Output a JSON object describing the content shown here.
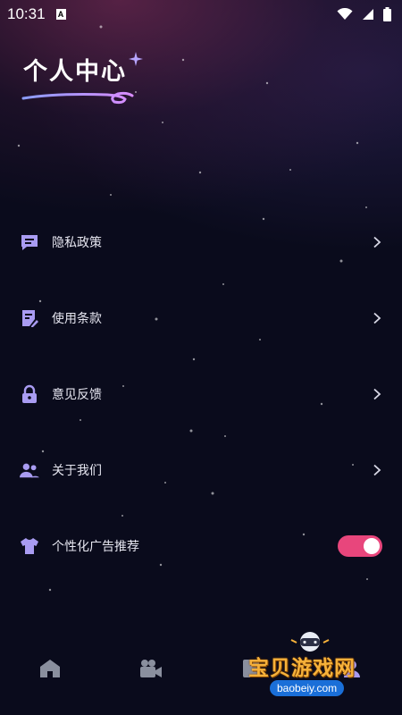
{
  "status_bar": {
    "time": "10:31",
    "notification_letter": "A",
    "icons": [
      "wifi-icon",
      "signal-icon",
      "battery-icon"
    ]
  },
  "header": {
    "title": "个人中心"
  },
  "menu": {
    "items": [
      {
        "label": "隐私政策",
        "icon": "message-square-icon",
        "action": "chevron-right"
      },
      {
        "label": "使用条款",
        "icon": "document-edit-icon",
        "action": "chevron-right"
      },
      {
        "label": "意见反馈",
        "icon": "lock-icon",
        "action": "chevron-right"
      },
      {
        "label": "关于我们",
        "icon": "users-icon",
        "action": "chevron-right"
      },
      {
        "label": "个性化广告推荐",
        "icon": "tshirt-icon",
        "action": "toggle",
        "toggle_on": true
      }
    ]
  },
  "bottom_nav": {
    "items": [
      {
        "icon": "home-icon"
      },
      {
        "icon": "video-camera-icon"
      },
      {
        "icon": "book-icon"
      },
      {
        "icon": "profile-icon"
      }
    ]
  },
  "watermark": {
    "text": "宝贝游戏网",
    "url": "baobeiy.com"
  },
  "colors": {
    "background": "#0a0b1c",
    "icon_accent": "#a99cf2",
    "toggle_on": "#e8467c",
    "text": "#e6e6f0"
  }
}
